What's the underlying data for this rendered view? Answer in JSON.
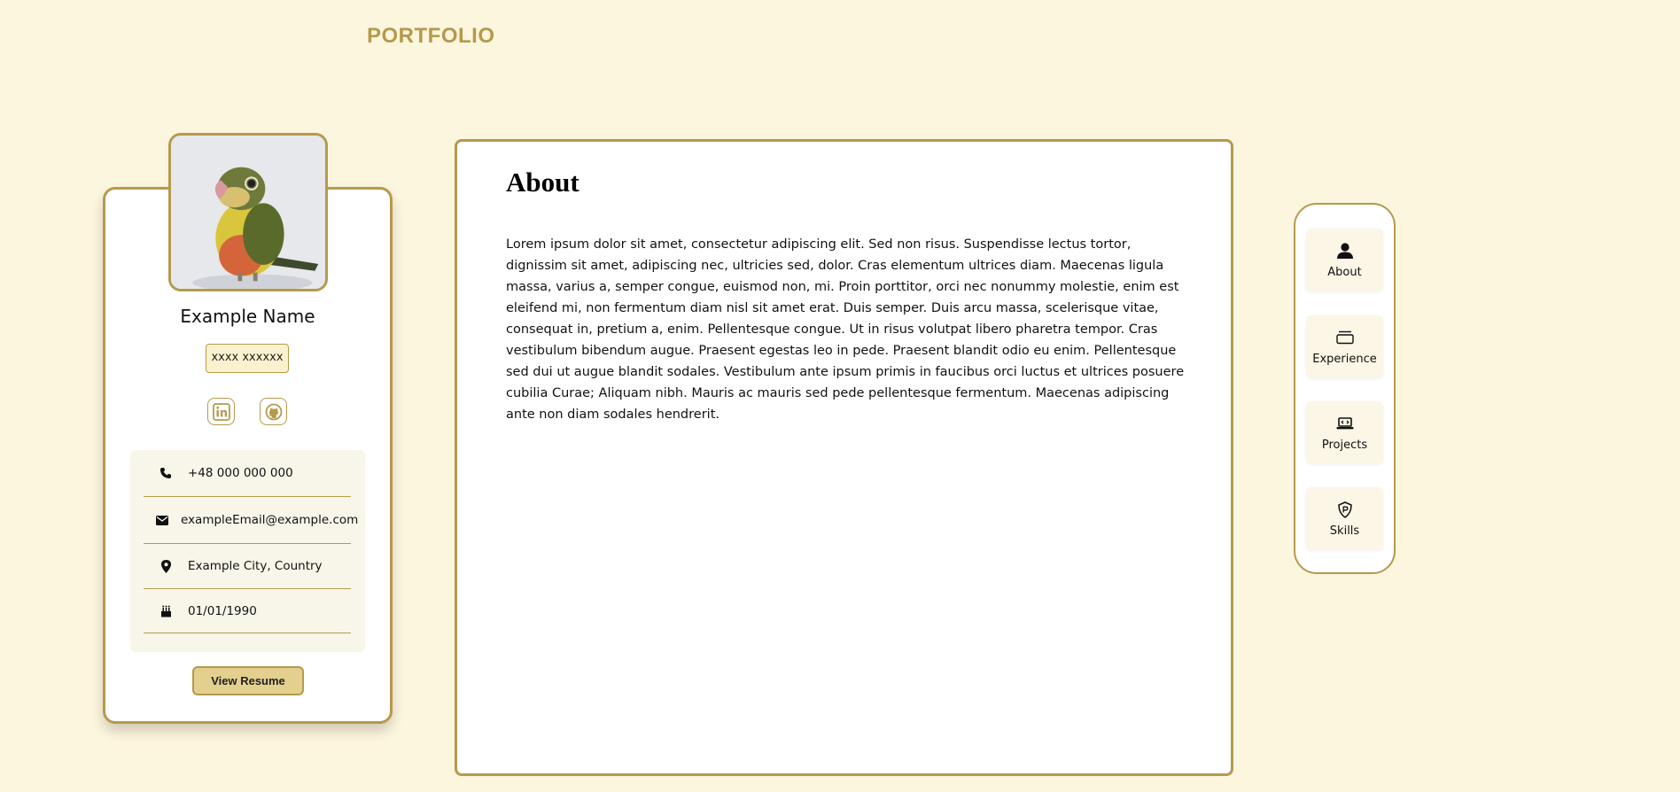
{
  "header": {
    "logo_text": "PORTFOLIO"
  },
  "profile": {
    "name": "Example Name",
    "title_chip": "xxxx xxxxxx",
    "avatar_icon": "parrot-photo",
    "social": [
      {
        "icon": "linkedin-icon"
      },
      {
        "icon": "github-icon"
      }
    ],
    "contacts": [
      {
        "icon": "phone-icon",
        "text": "+48 000 000 000"
      },
      {
        "icon": "envelope-icon",
        "text": "exampleEmail@example.com"
      },
      {
        "icon": "location-pin-icon",
        "text": "Example City, Country"
      },
      {
        "icon": "birthday-cake-icon",
        "text": "01/01/1990"
      }
    ],
    "resume_button": "View Resume"
  },
  "content": {
    "title": "About",
    "body": "Lorem ipsum dolor sit amet, consectetur adipiscing elit. Sed non risus. Suspendisse lectus tortor, dignissim sit amet, adipiscing nec, ultricies sed, dolor. Cras elementum ultrices diam. Maecenas ligula massa, varius a, semper congue, euismod non, mi. Proin porttitor, orci nec nonummy molestie, enim est eleifend mi, non fermentum diam nisl sit amet erat. Duis semper. Duis arcu massa, scelerisque vitae, consequat in, pretium a, enim. Pellentesque congue. Ut in risus volutpat libero pharetra tempor. Cras vestibulum bibendum augue. Praesent egestas leo in pede. Praesent blandit odio eu enim. Pellentesque sed dui ut augue blandit sodales. Vestibulum ante ipsum primis in faucibus orci luctus et ultrices posuere cubilia Curae; Aliquam nibh. Mauris ac mauris sed pede pellentesque fermentum. Maecenas adipiscing ante non diam sodales hendrerit."
  },
  "nav": [
    {
      "label": "About",
      "icon": "person-icon"
    },
    {
      "label": "Experience",
      "icon": "cards-stack-icon"
    },
    {
      "label": "Projects",
      "icon": "laptop-code-icon"
    },
    {
      "label": "Skills",
      "icon": "shield-badge-icon"
    }
  ],
  "colors": {
    "background": "#fdf6de",
    "accent": "#b59a4c",
    "button_fill": "#e3d08e",
    "contact_box": "#f8f6e9"
  }
}
